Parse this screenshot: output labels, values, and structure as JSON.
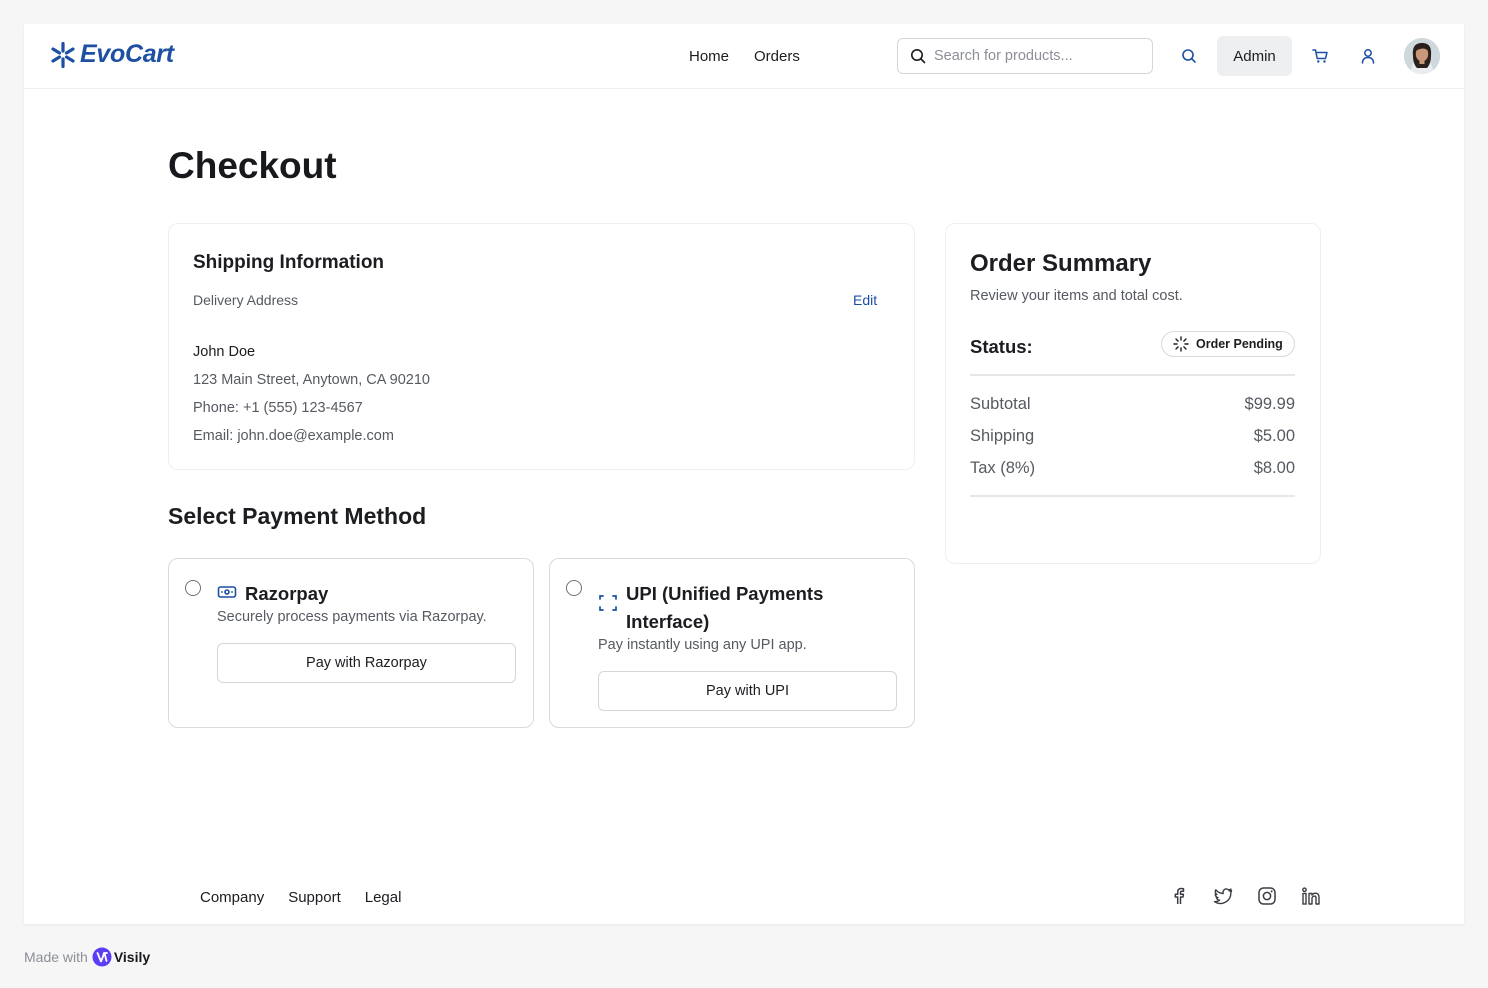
{
  "header": {
    "logo_text": "EvoCart",
    "nav": [
      {
        "label": "Home"
      },
      {
        "label": "Orders"
      }
    ],
    "search_placeholder": "Search for products...",
    "admin_label": "Admin"
  },
  "page": {
    "title": "Checkout"
  },
  "shipping": {
    "title": "Shipping Information",
    "subtitle": "Delivery Address",
    "edit_label": "Edit",
    "name": "John Doe",
    "address": "123 Main Street, Anytown, CA 90210",
    "phone": "Phone: +1 (555) 123-4567",
    "email": "Email: john.doe@example.com"
  },
  "payment": {
    "heading": "Select Payment Method",
    "methods": [
      {
        "name": "Razorpay",
        "description": "Securely process payments via Razorpay.",
        "button": "Pay with Razorpay",
        "icon": "banknote-icon"
      },
      {
        "name": "UPI (Unified Payments Interface)",
        "description": "Pay instantly using any UPI app.",
        "button": "Pay with UPI",
        "icon": "scan-icon"
      }
    ]
  },
  "summary": {
    "title": "Order Summary",
    "subtitle": "Review your items and total cost.",
    "status_label": "Status:",
    "status_value": "Order Pending",
    "rows": [
      {
        "label": "Subtotal",
        "value": "$99.99"
      },
      {
        "label": "Shipping",
        "value": "$5.00"
      },
      {
        "label": "Tax (8%)",
        "value": "$8.00"
      }
    ]
  },
  "footer": {
    "links": [
      {
        "label": "Company"
      },
      {
        "label": "Support"
      },
      {
        "label": "Legal"
      }
    ],
    "socials": [
      "facebook-icon",
      "twitter-icon",
      "instagram-icon",
      "linkedin-icon"
    ]
  },
  "badge": {
    "made_with": "Made with",
    "brand": "Visily"
  },
  "colors": {
    "brand": "#1d4fa3",
    "text": "#1b1d21",
    "muted": "#565a61",
    "border": "#d8dadd"
  }
}
